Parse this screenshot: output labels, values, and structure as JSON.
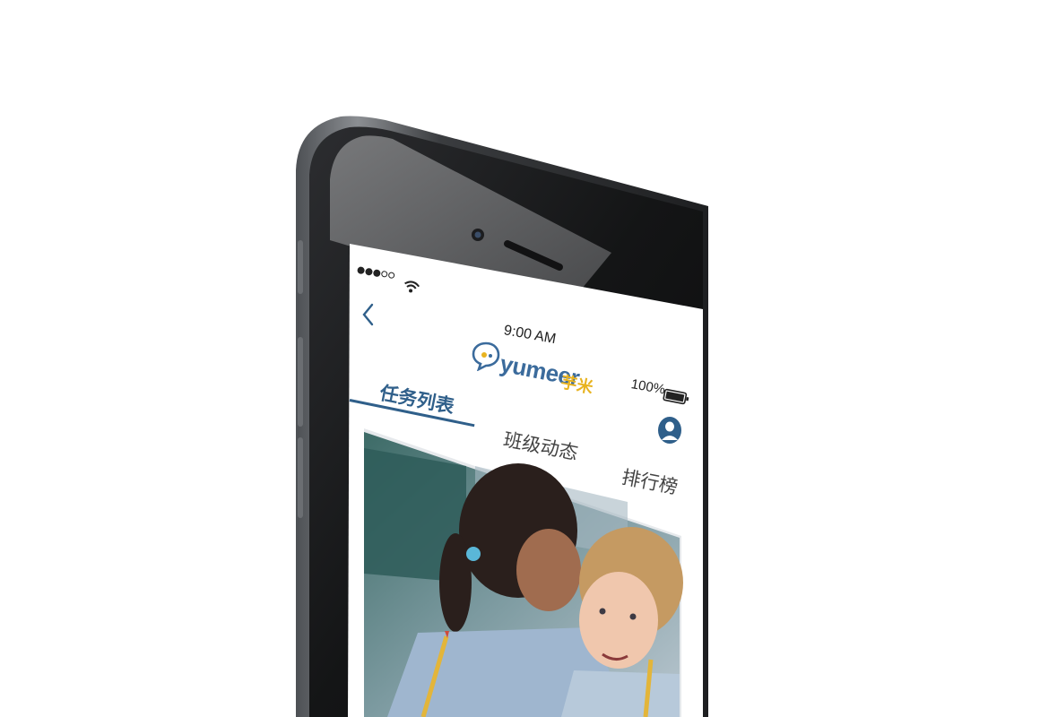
{
  "status_bar": {
    "signal_filled": 3,
    "signal_total": 5,
    "time": "9:00 AM",
    "battery": "100%"
  },
  "app": {
    "logo_word": "yumeer",
    "logo_cn": "芋米"
  },
  "tabs": [
    {
      "label": "任务列表",
      "active": true
    },
    {
      "label": "班级动态",
      "active": false
    },
    {
      "label": "排行榜",
      "active": false
    }
  ],
  "icons": {
    "back": "chevron-left-icon",
    "wifi": "wifi-icon",
    "battery": "battery-icon",
    "avatar": "user-avatar-icon",
    "logo": "speech-bubble-logo-icon"
  },
  "colors": {
    "brand_blue": "#2f5f8a",
    "logo_yellow": "#e8b320",
    "phone_body": "#2b2d30"
  },
  "content": {
    "image": "photo of two school girls whispering, holding pencils"
  }
}
